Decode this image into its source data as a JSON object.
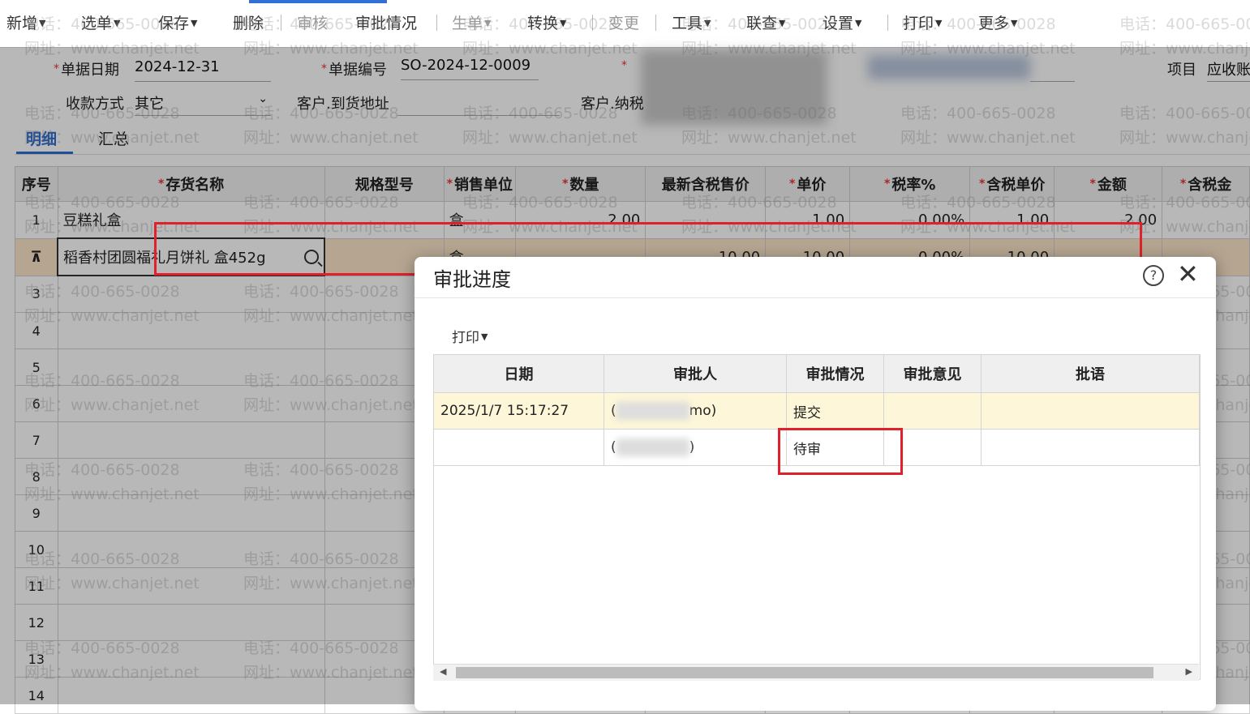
{
  "toolbar": {
    "new": "新增",
    "select": "选单",
    "save": "保存",
    "delete": "删除",
    "audit": "审核",
    "approval_status": "审批情况",
    "generate": "生单",
    "convert": "转换",
    "change": "变更",
    "tools": "工具",
    "lookup": "联查",
    "settings": "设置",
    "print": "打印",
    "more": "更多"
  },
  "form": {
    "date_label": "单据日期",
    "date_value": "2024-12-31",
    "code_label": "单据编号",
    "code_value": "SO-2024-12-0009",
    "project_label": "项目",
    "project_value": "应收账",
    "payment_label": "收款方式",
    "payment_value": "其它",
    "address_label": "客户.到货地址",
    "taxpayer_label": "客户.纳税"
  },
  "tabs": {
    "detail": "明细",
    "summary": "汇总"
  },
  "grid": {
    "headers": [
      "序号",
      "存货名称",
      "规格型号",
      "销售单位",
      "数量",
      "最新含税售价",
      "单价",
      "税率%",
      "含税单价",
      "金额",
      "含税金"
    ],
    "rows": [
      {
        "idx": "1",
        "name": "豆糕礼盒",
        "unit": "盒",
        "qty": "2.00",
        "latest": "",
        "price": "1.00",
        "tax": "0.00%",
        "taxprice": "1.00",
        "amount": "2.00"
      },
      {
        "idx": "",
        "name": "稻香村团圆福礼月饼礼 盒452g",
        "unit": "盒",
        "qty": "",
        "latest": "10.00",
        "price": "10.00",
        "tax": "0.00%",
        "taxprice": "10.00",
        "amount": ""
      }
    ],
    "row_numbers": [
      "3",
      "4",
      "5",
      "6",
      "7",
      "8",
      "9",
      "10",
      "11",
      "12",
      "13",
      "14"
    ]
  },
  "dialog": {
    "title": "审批进度",
    "print": "打印",
    "headers": [
      "日期",
      "审批人",
      "审批情况",
      "审批意见",
      "批语"
    ],
    "rows": [
      {
        "date": "2025/1/7 15:17:27",
        "approver_suffix": "mo)",
        "status": "提交",
        "opinion": "",
        "comment": ""
      },
      {
        "date": "",
        "approver_suffix": ")",
        "status": "待审",
        "opinion": "",
        "comment": ""
      }
    ]
  },
  "watermark": {
    "phone": "电话：400-665-0028",
    "site": "网址：www.chanjet.net"
  },
  "colors": {
    "accent": "#2f6fd6",
    "highlight_box": "#e0202a",
    "selected_row": "#fbe5c9"
  }
}
